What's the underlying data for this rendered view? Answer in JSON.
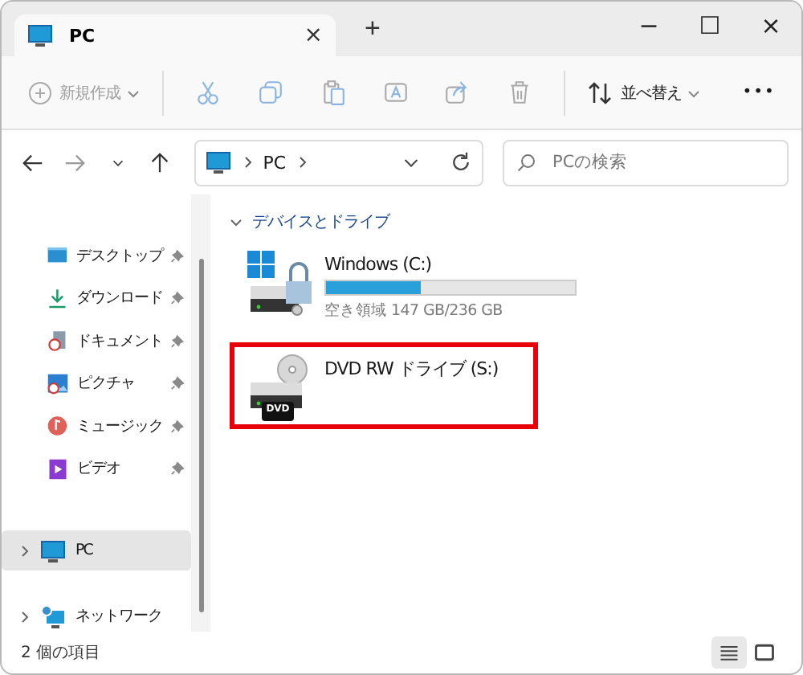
{
  "tabs": [
    {
      "label": "PC",
      "selected": true,
      "close": "×"
    }
  ],
  "new_tab": "+",
  "window_controls": [
    "−",
    "☐",
    "×"
  ],
  "toolbar": [
    {
      "kind": "menu",
      "label": "新規作成",
      "disabled": true
    },
    {
      "kind": "icon",
      "disabled": true
    },
    {
      "kind": "icon",
      "disabled": true
    },
    {
      "kind": "icon",
      "disabled": true
    },
    {
      "kind": "icon",
      "disabled": true
    },
    {
      "kind": "icon",
      "disabled": true
    },
    {
      "kind": "icon",
      "disabled": true
    },
    {
      "kind": "menu",
      "label": "並べ替え",
      "disabled": false
    },
    {
      "kind": "more",
      "label": "•••",
      "disabled": false
    }
  ],
  "navigation": [
    {
      "disabled": false
    },
    {
      "disabled": true
    },
    {
      "disabled": false
    },
    {
      "disabled": false
    }
  ],
  "address": {
    "path": [
      "PC"
    ]
  },
  "search": {
    "placeholder": "PCの検索"
  },
  "sidebar": {
    "quick_access": [
      {
        "label": "デスクトップ",
        "pinned": true
      },
      {
        "label": "ダウンロード",
        "pinned": true
      },
      {
        "label": "ドキュメント",
        "pinned": true
      },
      {
        "label": "ピクチャ",
        "pinned": true
      },
      {
        "label": "ミュージック",
        "pinned": true
      },
      {
        "label": "ビデオ",
        "pinned": true
      }
    ],
    "locations": [
      {
        "label": "PC",
        "selected": true,
        "expanded": false
      },
      {
        "label": "ネットワーク",
        "selected": false,
        "expanded": false
      }
    ]
  },
  "content": {
    "group": "デバイスとドライブ",
    "expanded": true,
    "drives": [
      {
        "kind": "disk",
        "name": "Windows (C:)",
        "level": 0.38,
        "free": "空き領域 147 GB/236 GB",
        "highlighted": false
      },
      {
        "kind": "dvd",
        "name": "DVD RW ドライブ (S:)",
        "badge": "DVD",
        "highlighted": true
      }
    ]
  },
  "status_bar": {
    "count": "2 個の項目",
    "view": [
      {
        "selected": true
      },
      {
        "selected": false
      }
    ]
  }
}
